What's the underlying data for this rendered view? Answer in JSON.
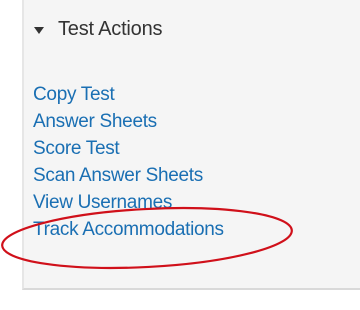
{
  "panel": {
    "header_label": "Test Actions",
    "header_icon": "caret-down-icon",
    "accent_color": "#1a6fb3",
    "highlight_color": "#d0101a",
    "actions": [
      {
        "label": "Copy Test"
      },
      {
        "label": "Answer Sheets"
      },
      {
        "label": "Score Test"
      },
      {
        "label": "Scan Answer Sheets"
      },
      {
        "label": "View Usernames"
      },
      {
        "label": "Track Accommodations"
      }
    ]
  }
}
